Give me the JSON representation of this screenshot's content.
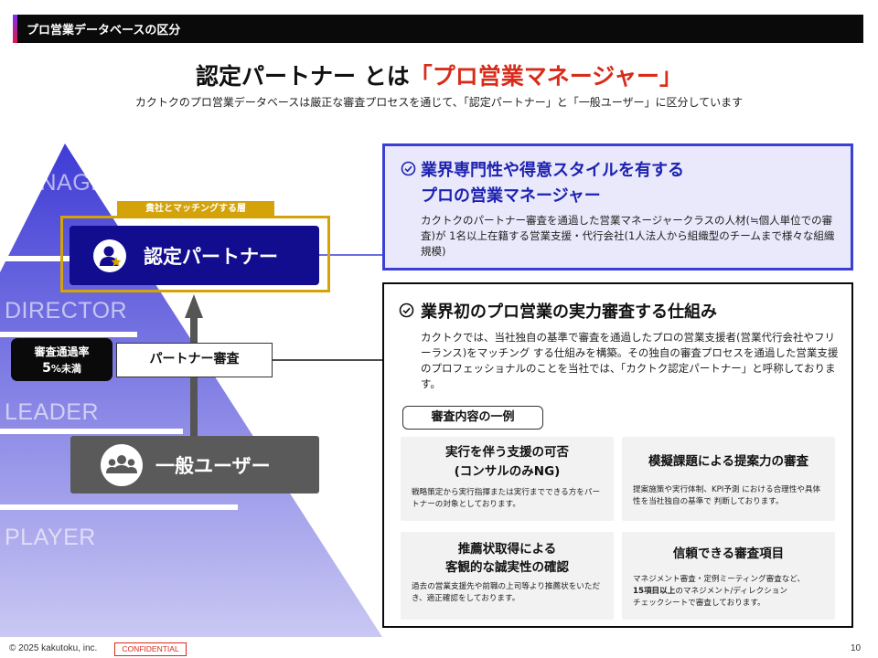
{
  "header": {
    "title": "プロ営業データベースの区分"
  },
  "title": {
    "main": "認定パートナー とは",
    "highlight": "「プロ営業マネージャー」"
  },
  "subtitle": "カクトクのプロ営業データベースは厳正な審査プロセスを通じて、「認定パートナー」と「一般ユーザー」に区分しています",
  "pyramid": {
    "levels": [
      "MANAGER",
      "DIRECTOR",
      "LEADER",
      "PLAYER"
    ],
    "match_tag": "貴社とマッチングする層",
    "partner_label": "認定パートナー",
    "pass_rate": {
      "line1": "審査通過率",
      "value": "5",
      "unit": "%未満"
    },
    "review_label": "パートナー審査",
    "general_label": "一般ユーザー"
  },
  "card1": {
    "title_line1": "業界専門性や得意スタイルを有する",
    "title_line2": "プロの営業マネージャー",
    "desc": "カクトクのパートナー審査を通過した営業マネージャークラスの人材(≒個人単位での審査)が 1名以上在籍する営業支援・代行会社(1人法人から組織型のチームまで様々な組織規模)"
  },
  "card2": {
    "title": "業界初のプロ営業の実力審査する仕組み",
    "desc": "カクトクでは、当社独自の基準で審査を通過したプロの営業支援者(営業代行会社やフリーランス)をマッチング する仕組みを構築。その独自の審査プロセスを通過した営業支援のプロフェッショナルのことを当社では、「カクトク認定パートナー」と呼称しております。",
    "example_label": "審査内容の一例",
    "items": [
      {
        "title_line1": "実行を伴う支援の可否",
        "title_line2": "(コンサルのみNG)",
        "desc": "戦略策定から実行指揮または実行までできる方をパートナーの対象としております。"
      },
      {
        "title_line1": "模擬課題による提案力の審査",
        "title_line2": "",
        "desc": "提案施策や実行体制、KPI予測 における合理性や具体性を当社独自の基準で 判断しております。"
      },
      {
        "title_line1": "推薦状取得による",
        "title_line2": "客観的な誠実性の確認",
        "desc": "過去の営業支援先や前職の上司等より推薦状をいただき、適正確認をしております。"
      },
      {
        "title_line1": "信頼できる審査項目",
        "title_line2": "",
        "desc_line1": "マネジメント審査・定例ミーティング審査など、",
        "desc_bold": "15項目以上",
        "desc_line2": "のマネジメント/ディレクション",
        "desc_line3": "チェックシートで審査しております。"
      }
    ]
  },
  "footer": {
    "copyright": "© 2025 kakutoku, inc.",
    "confidential": "CONFIDENTIAL",
    "page": "10"
  },
  "colors": {
    "accent_red": "#d92b1a",
    "navy": "#120c8f",
    "gold": "#d4a30a",
    "card_blue": "#3b3fd3"
  }
}
